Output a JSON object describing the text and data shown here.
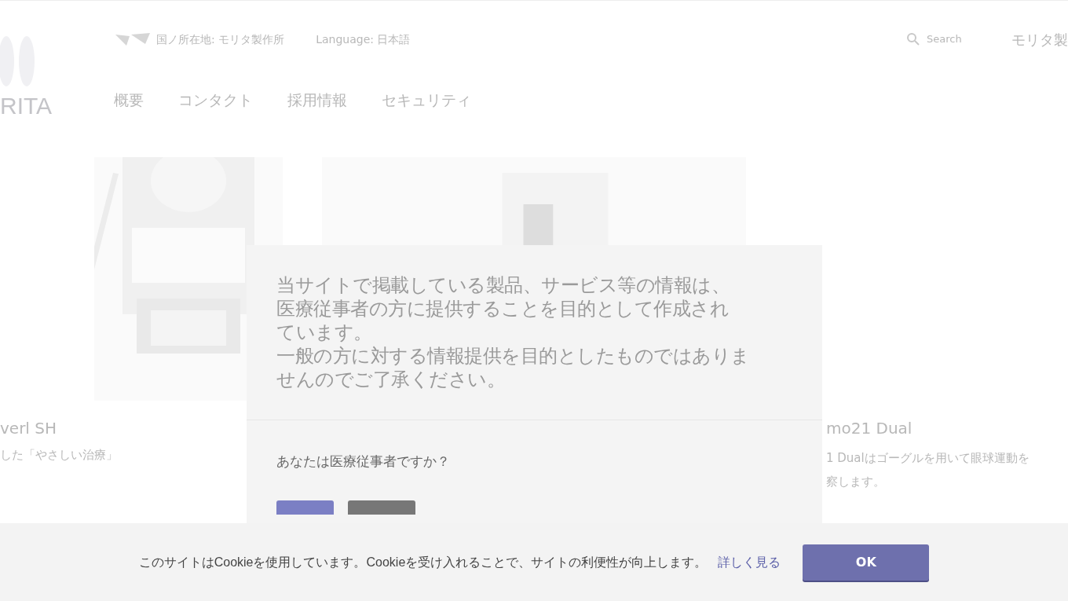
{
  "header": {
    "logo": "RITA",
    "region": "国ノ所在地: モリタ製作所",
    "language": "Language: 日本語",
    "search": {
      "placeholder": "Search"
    },
    "brand": "モリタ製"
  },
  "nav": [
    "概要",
    "コンタクト",
    "採用情報",
    "セキュリティ"
  ],
  "products": [
    {
      "title": "verl SH",
      "text": "した「やさしい治療」"
    },
    {
      "title": "mo21 Dual",
      "text": "1 Dualはゴーグルを用いて眼球運動を",
      "text2": "察します。"
    }
  ],
  "modal": {
    "notice": [
      "当サイトで掲載している製品、サービス等の情報は、",
      "医療従事者の方に提供することを目的として作成され",
      "ています。",
      "一般の方に対する情報提供を目的としたものではありま",
      "せんのでご了承ください。"
    ],
    "question": "あなたは医療従事者ですか？",
    "buttons": [
      {
        "kind": "primary"
      },
      {
        "kind": "secondary"
      }
    ]
  },
  "cookie_bar": {
    "text": "このサイトはCookieを使用しています。Cookieを受け入れることで、サイトの利便性が向上します。",
    "link": "詳しく見る",
    "button": "OK"
  }
}
